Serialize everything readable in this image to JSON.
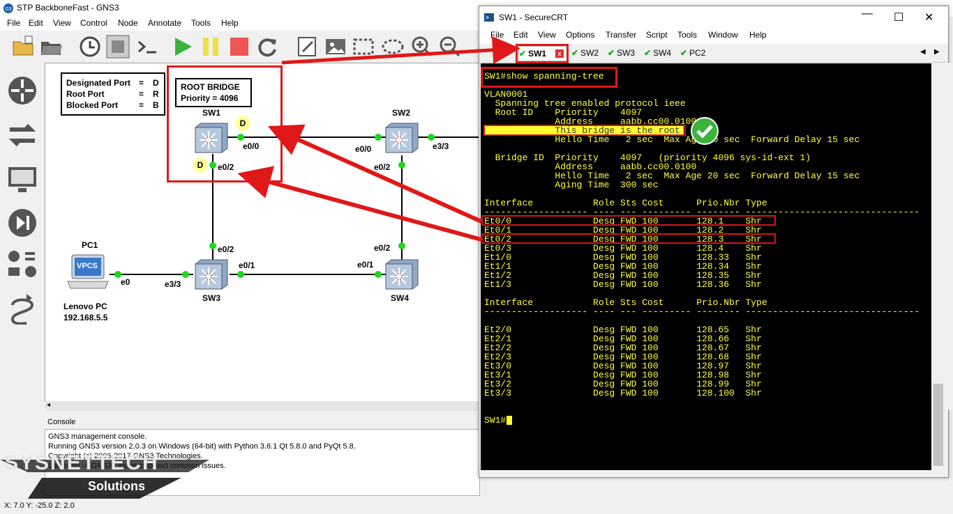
{
  "gns3": {
    "title": "STP BackboneFast - GNS3",
    "menu": [
      "File",
      "Edit",
      "View",
      "Control",
      "Node",
      "Annotate",
      "Tools",
      "Help"
    ],
    "toolbar_icons": [
      "open-project-icon",
      "open-folder-icon",
      "snapshot-clock-icon",
      "show-interfaces-icon",
      "console-icon",
      "start-icon",
      "pause-icon",
      "stop-icon",
      "reload-icon",
      "note-icon",
      "image-icon",
      "rectangle-icon",
      "ellipse-icon",
      "zoom-in-icon",
      "zoom-out-icon"
    ],
    "dock_icons": [
      "routers-icon",
      "switches-icon",
      "end-devices-icon",
      "security-devices-icon",
      "all-devices-icon",
      "add-link-icon"
    ],
    "legend": {
      "line1_label": "Designated Port",
      "line1_value": "D",
      "line2_label": "Root Port",
      "line2_value": "R",
      "line3_label": "Blocked Port",
      "line3_value": "B"
    },
    "root_bridge": {
      "line1": "ROOT BRIDGE",
      "line2": "Priority = 4096"
    },
    "nodes": {
      "sw1": "SW1",
      "sw2": "SW2",
      "sw3": "SW3",
      "sw4": "SW4",
      "pc1": "PC1",
      "pc1_name": "Lenovo PC",
      "pc1_ip": "192.168.5.5",
      "pc1_icon_text": "VPCS"
    },
    "ports": {
      "sw1_e00": "e0/0",
      "sw1_e02": "e0/2",
      "sw2_e00": "e0/0",
      "sw2_e33": "e3/3",
      "sw2_e02": "e0/2",
      "sw3_e02": "e0/2",
      "sw3_e01": "e0/1",
      "sw3_e33": "e3/3",
      "sw4_e02": "e0/2",
      "sw4_e01": "e0/1",
      "pc1_e0": "e0"
    },
    "badges": {
      "sw1_e00": "D",
      "sw1_e02": "D"
    },
    "console": {
      "header": "Console",
      "lines": [
        "GNS3 management console.",
        "Running GNS3 version 2.0.3 on Windows (64-bit) with Python 3.6.1 Qt 5.8.0 and PyQt 5.8.",
        "Copyright (c) 2006-2017 GNS3 Technologies.",
        "Use Help -> GNS3 Doctor to detect common issues."
      ]
    },
    "status": "X: 7.0 Y: -25.0 Z: 2.0",
    "watermark": {
      "brand": "SYSNETTECH",
      "sub": "Solutions"
    }
  },
  "securecrt": {
    "title": "SW1 - SecureCRT",
    "menu": [
      "File",
      "Edit",
      "View",
      "Options",
      "Transfer",
      "Script",
      "Tools",
      "Window",
      "Help"
    ],
    "tabs": [
      "SW1",
      "SW2",
      "SW3",
      "SW4",
      "PC2"
    ],
    "tab_close": "x",
    "terminal": {
      "command": "SW1#show spanning-tree",
      "vlan": "VLAN0001",
      "l1": "  Spanning tree enabled protocol ieee",
      "l2": "  Root ID    Priority    4097",
      "l3": "             Address     aabb.cc00.0100",
      "l4": "             This bridge is the root",
      "l5": "             Hello Time   2 sec  Max Age 20 sec  Forward Delay 15 sec",
      "l6": "  Bridge ID  Priority    4097   (priority 4096 sys-id-ext 1)",
      "l7": "             Address     aabb.cc00.0100",
      "l8": "             Hello Time   2 sec  Max Age 20 sec  Forward Delay 15 sec",
      "l9": "             Aging Time  300 sec",
      "hdr": "Interface           Role Sts Cost      Prio.Nbr Type",
      "sep": "------------------- ---- --- --------- -------- --------------------------------",
      "rows1": [
        "Et0/0               Desg FWD 100       128.1    Shr",
        "Et0/1               Desg FWD 100       128.2    Shr",
        "Et0/2               Desg FWD 100       128.3    Shr",
        "Et0/3               Desg FWD 100       128.4    Shr",
        "Et1/0               Desg FWD 100       128.33   Shr",
        "Et1/1               Desg FWD 100       128.34   Shr",
        "Et1/2               Desg FWD 100       128.35   Shr",
        "Et1/3               Desg FWD 100       128.36   Shr"
      ],
      "hdr2": "Interface           Role Sts Cost      Prio.Nbr Type",
      "sep2": "------------------- ---- --- --------- -------- --------------------------------",
      "rows2": [
        "Et2/0               Desg FWD 100       128.65   Shr",
        "Et2/1               Desg FWD 100       128.66   Shr",
        "Et2/2               Desg FWD 100       128.67   Shr",
        "Et2/3               Desg FWD 100       128.68   Shr",
        "Et3/0               Desg FWD 100       128.97   Shr",
        "Et3/1               Desg FWD 100       128.98   Shr",
        "Et3/2               Desg FWD 100       128.99   Shr",
        "Et3/3               Desg FWD 100       128.100  Shr"
      ],
      "prompt": "SW1#"
    }
  }
}
